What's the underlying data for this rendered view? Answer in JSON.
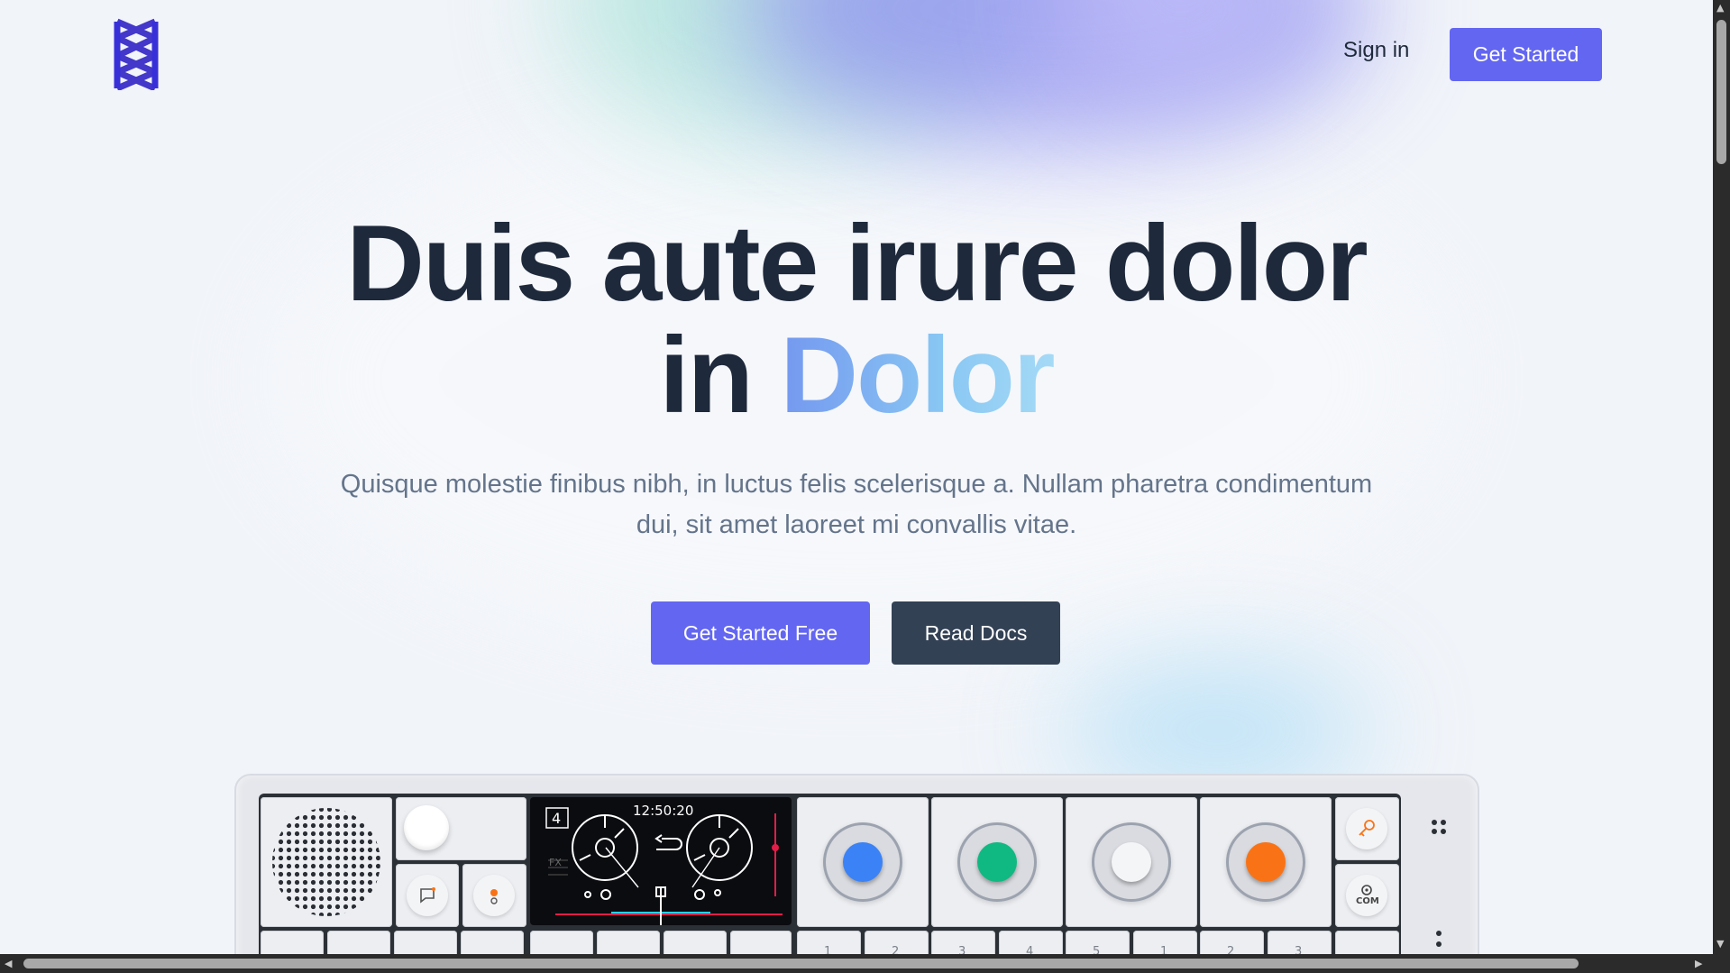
{
  "header": {
    "logo_icon": "stacked-chevron-x-logo",
    "sign_in_label": "Sign in",
    "get_started_label": "Get Started"
  },
  "hero": {
    "title_line1": "Duis aute irure dolor",
    "title_line2_prefix": "in",
    "title_line2_accent": "Dolor",
    "subtitle": "Quisque molestie finibus nibh, in luctus felis scelerisque a. Nullam pharetra condimentum dui, sit amet laoreet mi convallis vitae.",
    "primary_cta": "Get Started Free",
    "secondary_cta": "Read Docs"
  },
  "device": {
    "screen_index": "4",
    "screen_time": "12:50:20",
    "screen_fx": "FX",
    "com_label": "COM",
    "key_numbers": [
      "1",
      "2",
      "3",
      "4",
      "5",
      "1",
      "2",
      "3"
    ]
  },
  "colors": {
    "accent": "#6366f1",
    "dark_button": "#334155",
    "heading": "#1e293b",
    "body_text": "#64748b",
    "knob_blue": "#3b82f6",
    "knob_green": "#10b981",
    "knob_white": "#f4f5f7",
    "knob_orange": "#f97316"
  }
}
